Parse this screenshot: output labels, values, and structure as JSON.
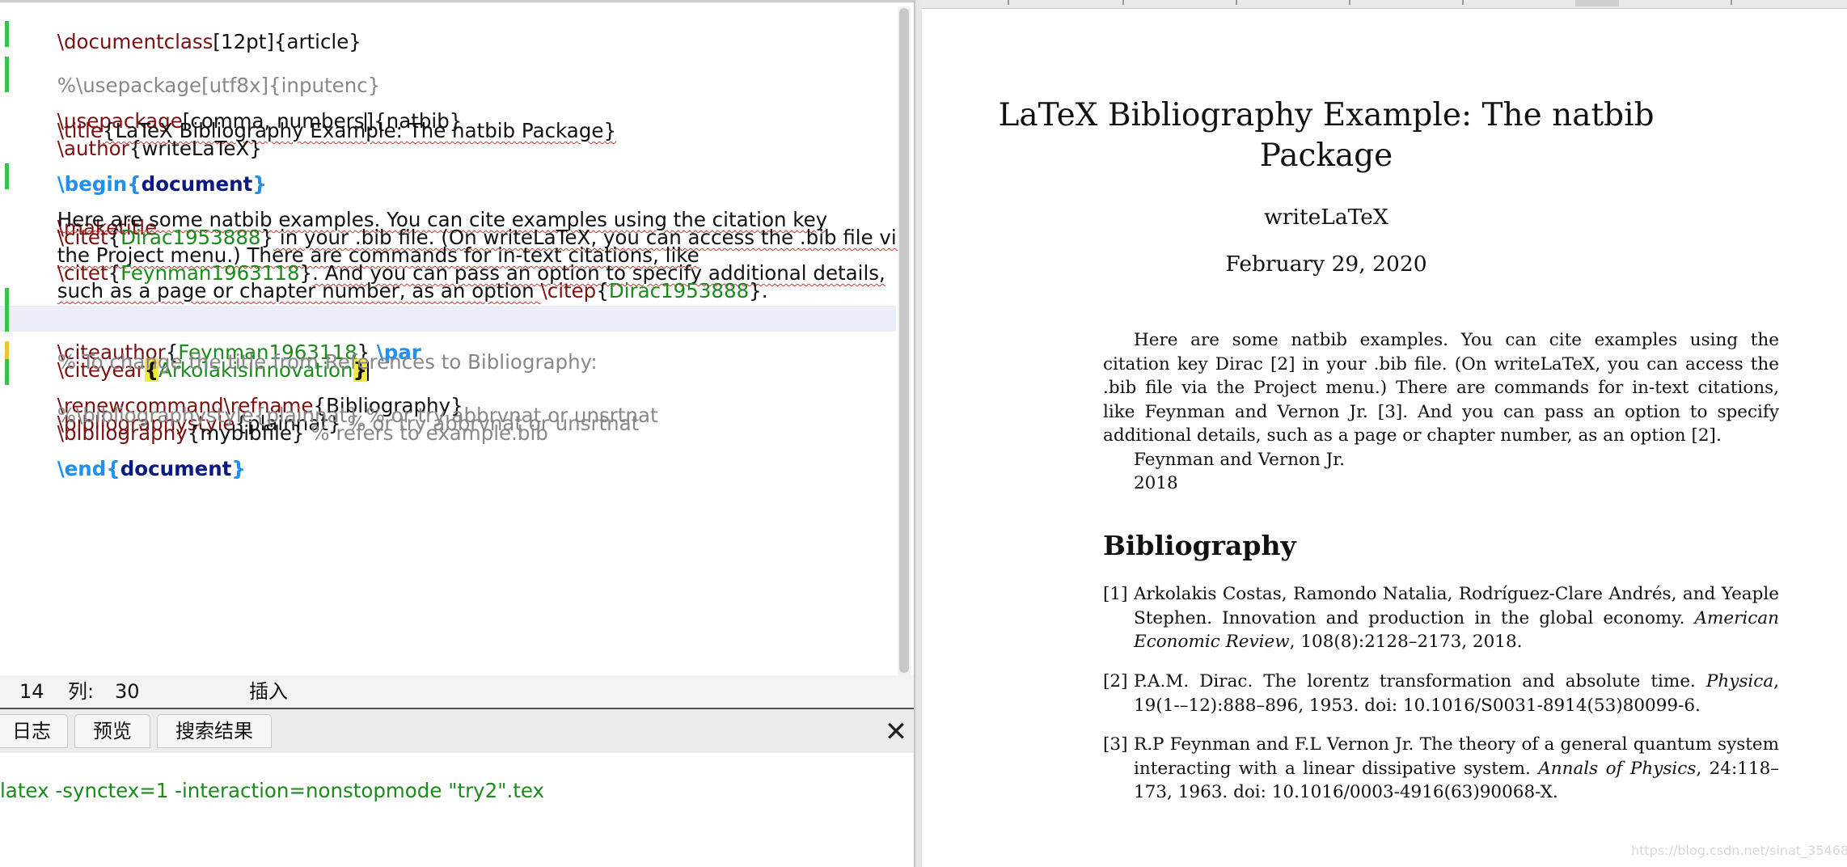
{
  "editor": {
    "lines": {
      "l1": {
        "cmd": "\\documentclass",
        "opt": "[12pt]",
        "arg": "{article}"
      },
      "l2": "%\\usepackage[utf8x]{inputenc}",
      "l4": {
        "cmd": "\\usepackage",
        "opt": "[comma, numbers",
        "opt_end": "]",
        "arg": "{natbib}"
      },
      "l6": {
        "cmd": "\\title",
        "arg": "{LaTeX Bibliography Example: The natbib Package}"
      },
      "l7": {
        "cmd": "\\author",
        "arg": "{writeLaTeX}"
      },
      "l9": {
        "cmd": "\\begin",
        "b1": "{",
        "env": "document",
        "b2": "}"
      },
      "l10": {
        "cmd": "\\maketitle"
      },
      "l11": "Here are some natbib examples. You can cite examples using the citation key",
      "l12": {
        "cmd": "\\citet",
        "b1": "{",
        "key": "Dirac1953888",
        "b2": "}",
        "rest": " in your .bib file. (On writeLaTeX, you can access the .bib file via"
      },
      "l13": "the Project menu.) There are commands for in-text citations, like",
      "l14": {
        "cmd": "\\citet",
        "b1": "{",
        "key": "Feynman1963118",
        "b2": "}",
        "rest": ". And you can pass an option to specify additional details,"
      },
      "l15": {
        "text": "such as a page or chapter number, as an option ",
        "cmd": "\\citep",
        "b1": "{",
        "key": "Dirac1953888",
        "b2": "}."
      },
      "l17": {
        "cmd": "\\citeauthor",
        "b1": "{",
        "key": "Feynman1963118",
        "b2": "}",
        "par": " \\par"
      },
      "l18": {
        "cmd": "\\citeyear",
        "b1": "{",
        "key": "ArkolakisInnovation",
        "b2": "}"
      },
      "l19": "% To change the title from References to Bibliography:",
      "l20": {
        "cmd": "\\renewcommand\\refname",
        "arg": "{Bibliography}"
      },
      "l21": {
        "cmd": "\\bibliographystyle",
        "arg": "{plainnat}",
        "comment": " % or try abbrvnat or unsrtnat"
      },
      "l22": "%\\bibliographystyle{plainnat} % or try abbrvnat or unsrtnat",
      "l23": {
        "cmd": "\\bibliography",
        "arg": "{mybibfile}",
        "comment": " % refers to example.bib"
      },
      "l25": {
        "cmd": "\\end",
        "b1": "{",
        "env": "document",
        "b2": "}"
      }
    }
  },
  "status": {
    "line_value": "14",
    "col_label": "列:",
    "col_value": "30",
    "mode": "插入"
  },
  "panel": {
    "tabs": [
      "日志",
      "预览",
      "搜索结果"
    ],
    "close": "✕"
  },
  "log": {
    "command": "latex -synctex=1 -interaction=nonstopmode \"try2\".tex"
  },
  "document": {
    "title_line1": "LaTeX Bibliography Example: The natbib",
    "title_line2": "Package",
    "author": "writeLaTeX",
    "date": "February 29, 2020",
    "paragraph": "Here are some natbib examples. You can cite examples using the citation key Dirac [2] in your .bib file. (On writeLaTeX, you can access the .bib file via the Project menu.) There are commands for in-text citations, like Feynman and Vernon Jr. [3]. And you can pass an option to specify additional details, such as a page or chapter number, as an option [2].",
    "citeauthor": "Feynman and Vernon Jr.",
    "citeyear": "2018",
    "bib_heading": "Bibliography",
    "bib": [
      {
        "num": "[1]",
        "pre": "Arkolakis Costas, Ramondo Natalia, Rodríguez-Clare Andrés, and Yeaple Stephen. Innovation and production in the global economy. ",
        "journal": "American Economic Review",
        "post": ", 108(8):2128–2173, 2018."
      },
      {
        "num": "[2]",
        "pre": "P.A.M. Dirac. The lorentz transformation and absolute time. ",
        "journal": "Physica",
        "post": ", 19(1-–12):888–896, 1953. doi: 10.1016/S0031-8914(53)80099-6."
      },
      {
        "num": "[3]",
        "pre": "R.P Feynman and F.L Vernon Jr. The theory of a general quantum system interacting with a linear dissipative system. ",
        "journal": "Annals of Physics",
        "post": ", 24:118–173, 1963. doi: 10.1016/0003-4916(63)90068-X."
      }
    ]
  },
  "watermark": "https://blog.csdn.net/sinat_35468224"
}
